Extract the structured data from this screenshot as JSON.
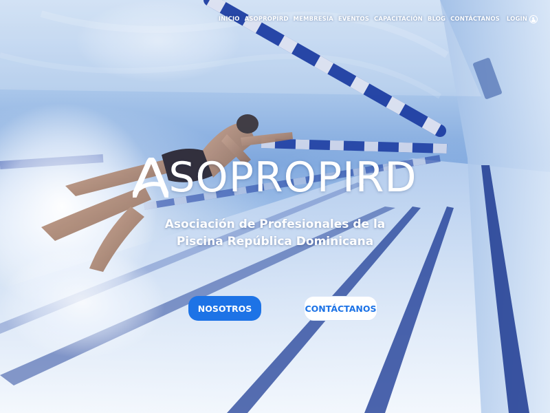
{
  "nav": {
    "items": [
      {
        "label": "INICIO"
      },
      {
        "label": "ASOPROPIRD"
      },
      {
        "label": "MEMBRESIA"
      },
      {
        "label": "EVENTOS"
      },
      {
        "label": "CAPACITACIÓN"
      },
      {
        "label": "BLOG"
      },
      {
        "label": "CONTÁCTANOS"
      }
    ],
    "login_label": "LOGIN",
    "login_icon": "user-circle-icon"
  },
  "hero": {
    "brand_mark": "A",
    "brand_rest": "SOPROPIRD",
    "subtitle_line1": "Asociación de Profesionales de la",
    "subtitle_line2": "Piscina República Dominicana",
    "primary_button": "NOSOTROS",
    "secondary_button": "CONTÁCTANOS"
  },
  "colors": {
    "accent": "#1d73e6",
    "water_deep": "#2a4fa8",
    "lane_line": "#1f3f9c",
    "text_light": "#ffffff"
  }
}
